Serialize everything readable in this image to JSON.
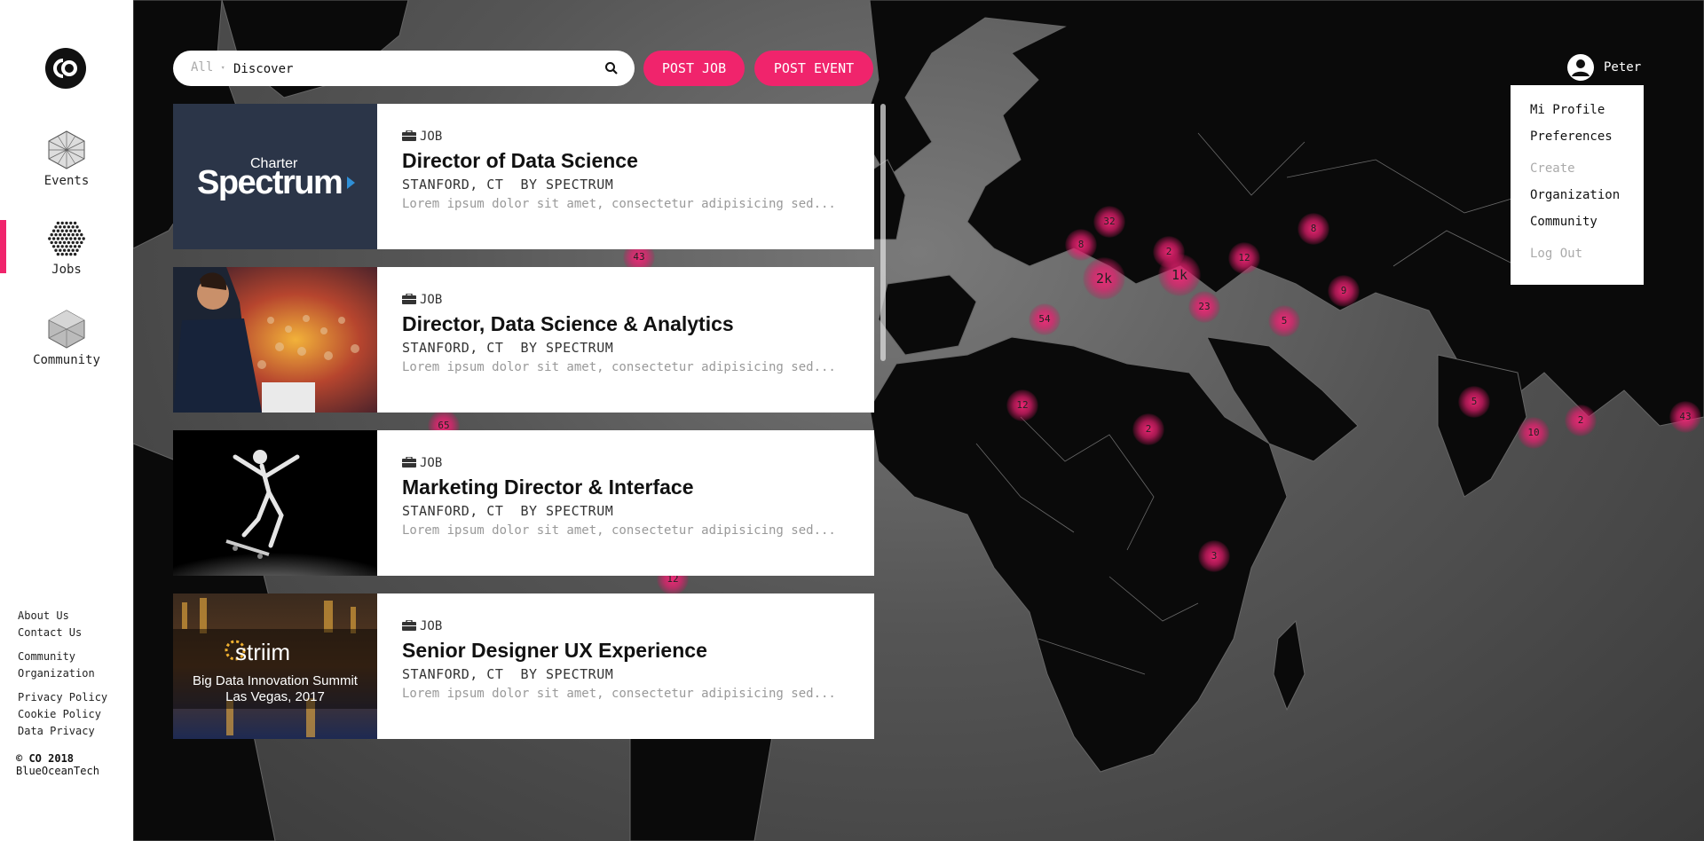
{
  "brand": {
    "logo_name": "co-logo"
  },
  "nav": [
    {
      "label": "Events",
      "icon": "events-icon"
    },
    {
      "label": "Jobs",
      "icon": "jobs-icon"
    },
    {
      "label": "Community",
      "icon": "community-icon"
    }
  ],
  "footer": {
    "groups": [
      [
        "About Us",
        "Contact Us"
      ],
      [
        "Community",
        "Organization"
      ],
      [
        "Privacy Policy",
        "Cookie Policy",
        "Data Privacy"
      ]
    ],
    "copyright": "© CO 2018",
    "company": "BlueOceanTech"
  },
  "search": {
    "scope": "All",
    "value": "Discover",
    "icon": "search-icon"
  },
  "actions": {
    "post_job": "POST JOB",
    "post_event": "POST EVENT"
  },
  "user": {
    "name": "Peter",
    "avatar_icon": "user-avatar-icon",
    "menu": [
      {
        "label": "Mi Profile",
        "muted": false
      },
      {
        "label": "Preferences",
        "muted": false
      },
      {
        "label": "Create",
        "muted": true
      },
      {
        "label": "Organization",
        "muted": false
      },
      {
        "label": "Community",
        "muted": false
      },
      {
        "label": "Log Out",
        "muted": true
      }
    ]
  },
  "map_clusters": [
    "43",
    "65",
    "12",
    "32",
    "8",
    "2k",
    "2",
    "1k",
    "12",
    "8",
    "23",
    "54",
    "9",
    "5",
    "12",
    "2",
    "5",
    "10",
    "2",
    "43",
    "3"
  ],
  "cards": [
    {
      "type": "JOB",
      "title": "Director of Data Science",
      "location": "STANFORD, CT",
      "company": "BY SPECTRUM",
      "desc": "Lorem ipsum dolor sit amet, consectetur adipisicing sed...",
      "image": {
        "kind": "logo",
        "line1": "Charter",
        "line2": "Spectrum"
      }
    },
    {
      "type": "JOB",
      "title": "Director, Data Science & Analytics",
      "location": "STANFORD, CT",
      "company": "BY SPECTRUM",
      "desc": "Lorem ipsum dolor sit amet, consectetur adipisicing sed...",
      "image": {
        "kind": "conference-photo"
      }
    },
    {
      "type": "JOB",
      "title": "Marketing Director & Interface",
      "location": "STANFORD, CT",
      "company": "BY SPECTRUM",
      "desc": "Lorem ipsum dolor sit amet, consectetur adipisicing sed...",
      "image": {
        "kind": "skateboarder-photo"
      }
    },
    {
      "type": "JOB",
      "title": "Senior Designer UX Experience",
      "location": "STANFORD, CT",
      "company": "BY SPECTRUM",
      "desc": "Lorem ipsum dolor sit amet, consectetur adipisicing sed...",
      "image": {
        "kind": "event-banner",
        "brand": "striim",
        "line1": "Big Data Innovation Summit",
        "line2": "Las Vegas, 2017"
      }
    }
  ],
  "colors": {
    "accent": "#f0246c",
    "sidebar": "#ffffff",
    "map_land": "#0a0a0a",
    "map_sea": "#555555"
  }
}
